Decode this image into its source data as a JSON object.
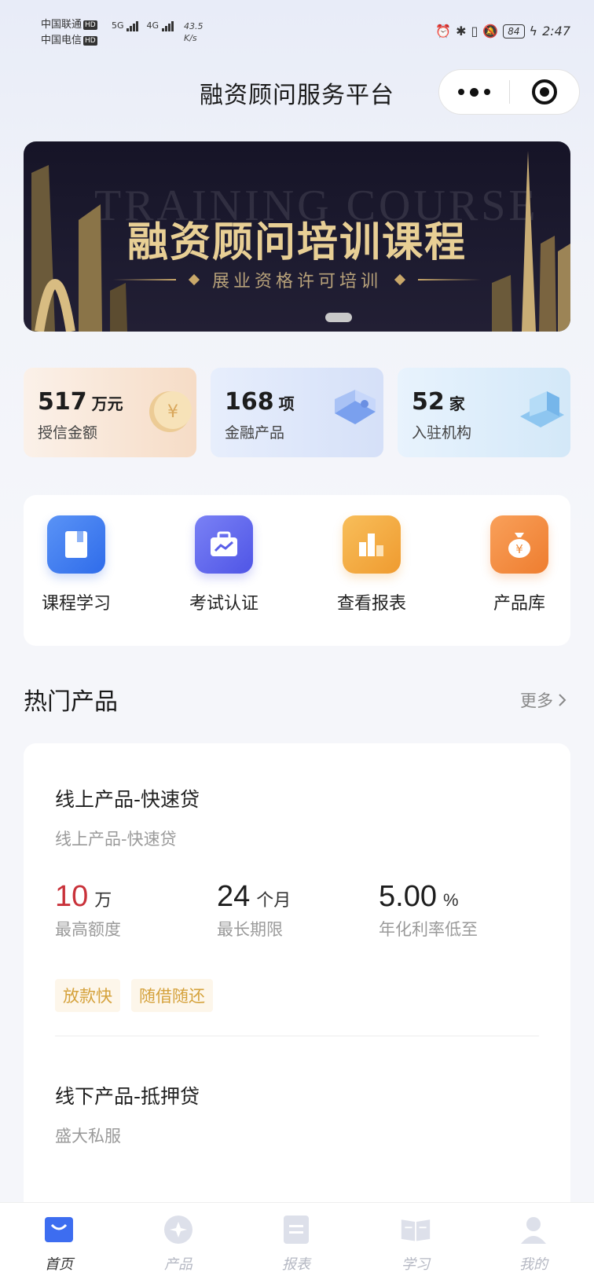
{
  "status_bar": {
    "carrier1": "中国联通",
    "carrier2": "中国电信",
    "hd": "HD",
    "net1": "5G",
    "net2": "4G",
    "speed_value": "43.5",
    "speed_unit": "K/s",
    "battery": "84",
    "time": "2:47"
  },
  "header": {
    "title": "融资顾问服务平台"
  },
  "banner": {
    "bg_text": "TRAINING COURSE",
    "title": "融资顾问培训课程",
    "subtitle": "展业资格许可培训"
  },
  "stats": [
    {
      "value": "517",
      "unit": "万元",
      "label": "授信金额"
    },
    {
      "value": "168",
      "unit": "项",
      "label": "金融产品"
    },
    {
      "value": "52",
      "unit": "家",
      "label": "入驻机构"
    }
  ],
  "shortcuts": [
    {
      "label": "课程学习",
      "icon": "book-icon",
      "color": "#3d7cf0"
    },
    {
      "label": "考试认证",
      "icon": "briefcase-chart-icon",
      "color": "#5b63ee"
    },
    {
      "label": "查看报表",
      "icon": "bar-chart-icon",
      "color": "#f2a33a"
    },
    {
      "label": "产品库",
      "icon": "money-bag-icon",
      "color": "#f08a3a"
    }
  ],
  "hot_products": {
    "title": "热门产品",
    "more": "更多",
    "items": [
      {
        "name": "线上产品-快速贷",
        "subtitle": "线上产品-快速贷",
        "amount": "10",
        "amount_unit": "万",
        "amount_label": "最高额度",
        "term": "24",
        "term_unit": "个月",
        "term_label": "最长期限",
        "rate": "5.00",
        "rate_unit": "%",
        "rate_label": "年化利率低至",
        "tags": [
          "放款快",
          "随借随还"
        ]
      },
      {
        "name": "线下产品-抵押贷",
        "subtitle": "盛大私服"
      }
    ]
  },
  "tabbar": [
    {
      "label": "首页",
      "icon": "home-bag-icon",
      "active": true
    },
    {
      "label": "产品",
      "icon": "product-star-icon",
      "active": false
    },
    {
      "label": "报表",
      "icon": "report-icon",
      "active": false
    },
    {
      "label": "学习",
      "icon": "open-book-icon",
      "active": false
    },
    {
      "label": "我的",
      "icon": "user-icon",
      "active": false
    }
  ],
  "colors": {
    "accent_blue": "#3d6df0",
    "price_red": "#c9323a",
    "tag_gold": "#d5a23c",
    "banner_gold": "#e8cf95"
  }
}
